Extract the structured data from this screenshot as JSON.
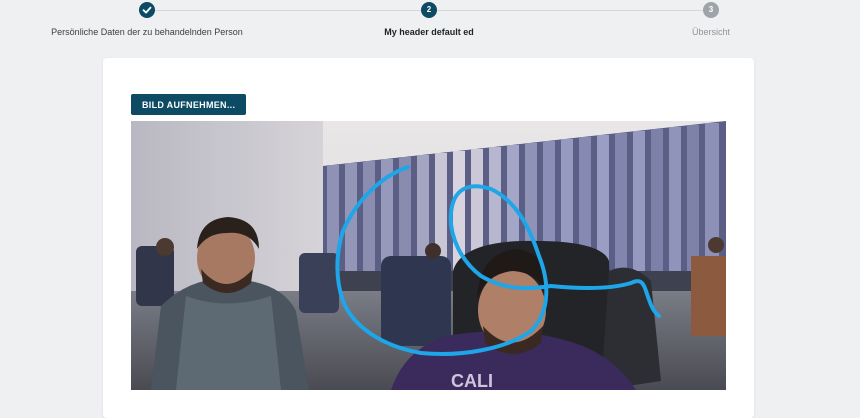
{
  "stepper": {
    "steps": [
      {
        "label": "Persönliche Daten der zu behandelnden Person",
        "marker": "✓",
        "state": "done"
      },
      {
        "label": "My header default ed",
        "marker": "2",
        "state": "active"
      },
      {
        "label": "Übersicht",
        "marker": "3",
        "state": "pending"
      }
    ]
  },
  "card": {
    "capture_button_label": "BILD AUFNEHMEN...",
    "photo": {
      "description_icon": "webcam-photo",
      "sweater_text": "CALI"
    }
  },
  "colors": {
    "primary": "#0d4a63",
    "pending_step": "#9ea4a9",
    "page_background": "#eef0f2",
    "drawing_stroke": "#1ea6e8"
  }
}
